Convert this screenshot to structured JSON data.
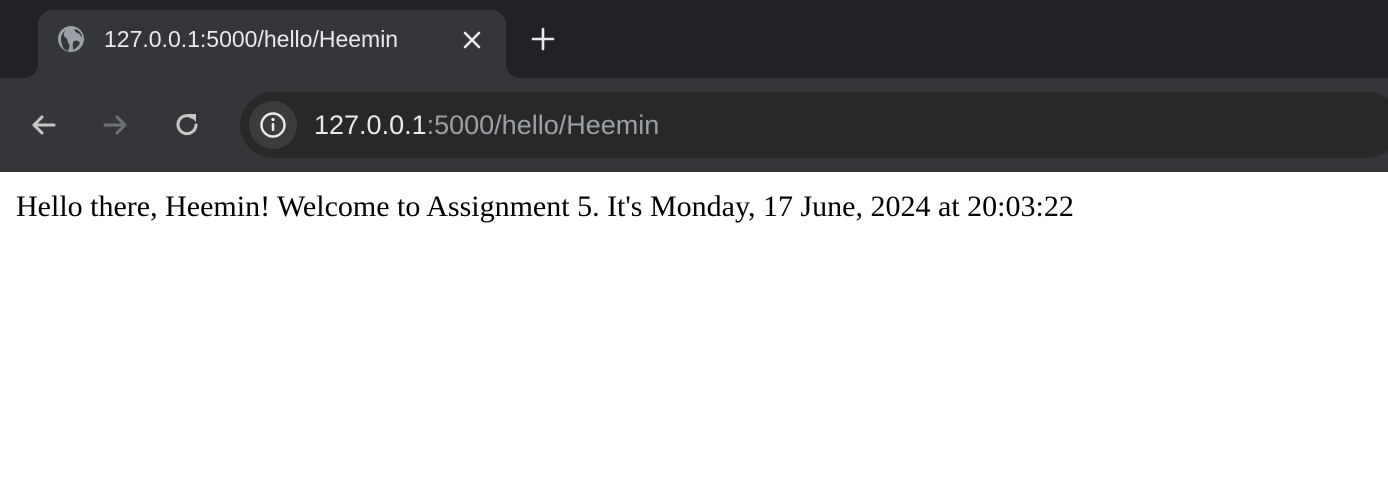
{
  "tab": {
    "title": "127.0.0.1:5000/hello/Heemin",
    "favicon": "globe-icon"
  },
  "toolbar": {
    "back_icon": "back-arrow-icon",
    "forward_icon": "forward-arrow-icon",
    "reload_icon": "reload-icon",
    "new_tab_icon": "plus-icon",
    "close_tab_icon": "close-icon"
  },
  "address_bar": {
    "site_info_icon": "info-icon",
    "host": "127.0.0.1",
    "rest": ":5000/hello/Heemin"
  },
  "page": {
    "greeting": "Hello there, Heemin! Welcome to Assignment 5. It's Monday, 17 June, 2024 at 20:03:22"
  },
  "colors": {
    "tabstrip_bg": "#202124",
    "active_tab_bg": "#35363a",
    "omnibox_bg": "#282828",
    "page_bg": "#ffffff"
  }
}
